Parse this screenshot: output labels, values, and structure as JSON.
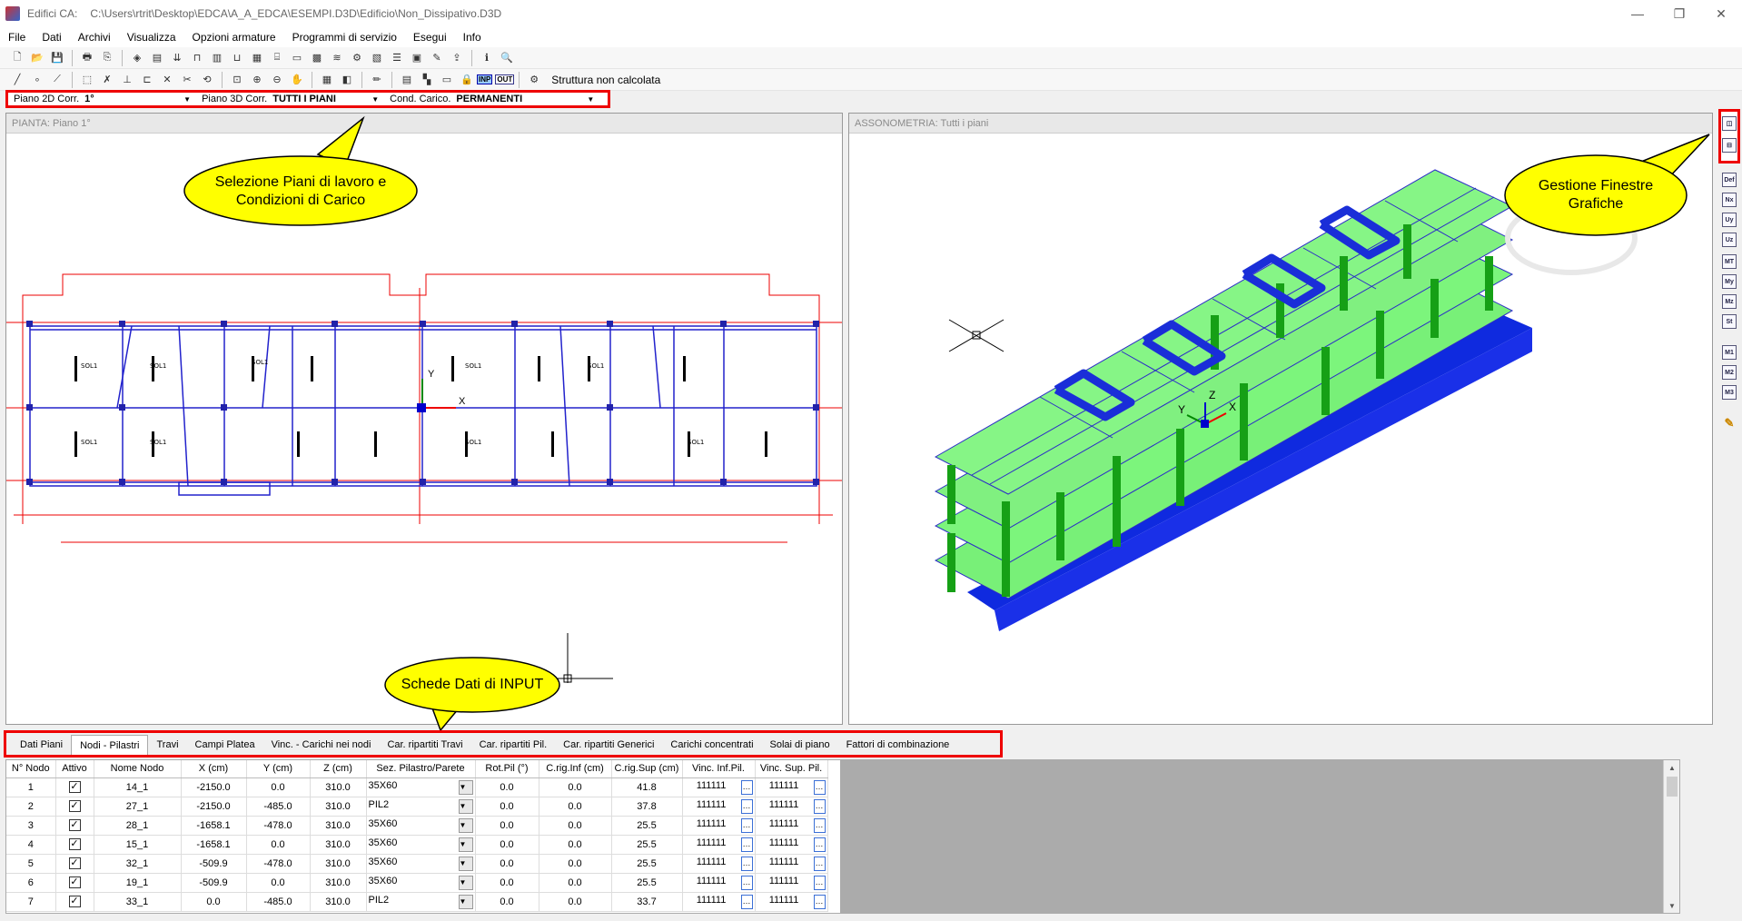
{
  "window": {
    "app_title": "Edifici CA:",
    "file_path": "C:\\Users\\rtrit\\Desktop\\EDCA\\A_A_EDCA\\ESEMPI.D3D\\Edificio\\Non_Dissipativo.D3D"
  },
  "menu": [
    "File",
    "Dati",
    "Archivi",
    "Visualizza",
    "Opzioni armature",
    "Programmi di servizio",
    "Esegui",
    "Info"
  ],
  "toolbar2": {
    "inp": "INP",
    "out": "OUT",
    "status": "Struttura non calcolata"
  },
  "selectors": {
    "piano2d_label": "Piano 2D Corr.",
    "piano2d_value": "1°",
    "piano3d_label": "Piano 3D Corr.",
    "piano3d_value": "TUTTI I PIANI",
    "cond_label": "Cond. Carico.",
    "cond_value": "PERMANENTI"
  },
  "panes": {
    "left_title": "PIANTA: Piano   1°",
    "right_title": "ASSONOMETRIA:  Tutti i piani",
    "plan_label": "SOL1",
    "axis_y": "Y",
    "axis_x": "X",
    "axis_z": "Z"
  },
  "callouts": {
    "selezione": "Selezione Piani di lavoro e Condizioni di Carico",
    "gestione": "Gestione Finestre Grafiche",
    "schede": "Schede Dati di INPUT"
  },
  "right_toolbar": [
    "Def",
    "Nx",
    "Uy",
    "Uz",
    "MT",
    "My",
    "Mz",
    "St",
    "M1",
    "M2",
    "M3"
  ],
  "tabs": [
    "Dati Piani",
    "Nodi - Pilastri",
    "Travi",
    "Campi Platea",
    "Vinc. - Carichi nei nodi",
    "Car. ripartiti Travi",
    "Car. ripartiti Pil.",
    "Car. ripartiti Generici",
    "Carichi concentrati",
    "Solai di piano",
    "Fattori di combinazione"
  ],
  "active_tab": "Nodi - Pilastri",
  "grid": {
    "headers": [
      "N° Nodo",
      "Attivo",
      "Nome Nodo",
      "X  (cm)",
      "Y  (cm)",
      "Z  (cm)",
      "Sez. Pilastro/Parete",
      "Rot.Pil (°)",
      "C.rig.Inf (cm)",
      "C.rig.Sup (cm)",
      "Vinc. Inf.Pil.",
      "Vinc. Sup. Pil."
    ],
    "rows": [
      [
        "1",
        "✓",
        "14_1",
        "-2150.0",
        "0.0",
        "310.0",
        "35X60",
        "0.0",
        "0.0",
        "41.8",
        "111111",
        "111111"
      ],
      [
        "2",
        "✓",
        "27_1",
        "-2150.0",
        "-485.0",
        "310.0",
        "PIL2",
        "0.0",
        "0.0",
        "37.8",
        "111111",
        "111111"
      ],
      [
        "3",
        "✓",
        "28_1",
        "-1658.1",
        "-478.0",
        "310.0",
        "35X60",
        "0.0",
        "0.0",
        "25.5",
        "111111",
        "111111"
      ],
      [
        "4",
        "✓",
        "15_1",
        "-1658.1",
        "0.0",
        "310.0",
        "35X60",
        "0.0",
        "0.0",
        "25.5",
        "111111",
        "111111"
      ],
      [
        "5",
        "✓",
        "32_1",
        "-509.9",
        "-478.0",
        "310.0",
        "35X60",
        "0.0",
        "0.0",
        "25.5",
        "111111",
        "111111"
      ],
      [
        "6",
        "✓",
        "19_1",
        "-509.9",
        "0.0",
        "310.0",
        "35X60",
        "0.0",
        "0.0",
        "25.5",
        "111111",
        "111111"
      ],
      [
        "7",
        "✓",
        "33_1",
        "0.0",
        "-485.0",
        "310.0",
        "PIL2",
        "0.0",
        "0.0",
        "33.7",
        "111111",
        "111111"
      ]
    ]
  }
}
